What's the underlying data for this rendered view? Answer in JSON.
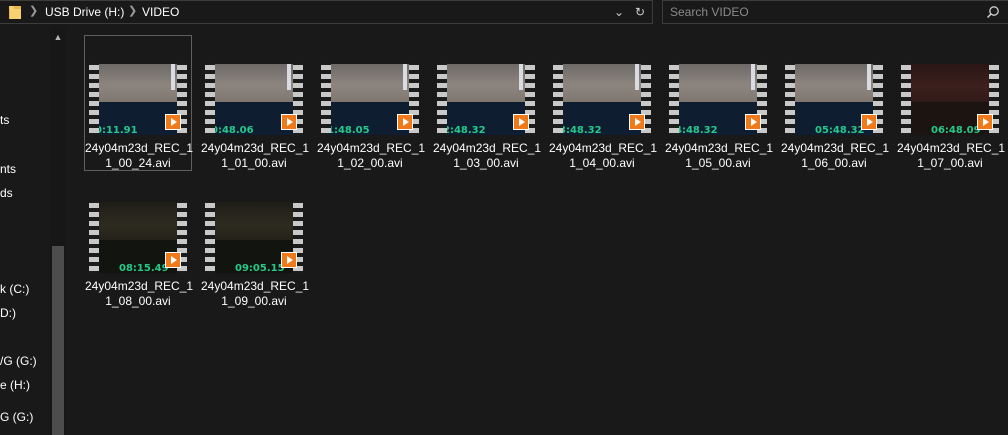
{
  "address": {
    "crumbs": [
      "USB Drive (H:)",
      "VIDEO"
    ],
    "folder_icon": "folder-icon",
    "dropdown_icon": "chevron-down-icon",
    "refresh_icon": "refresh-icon"
  },
  "search": {
    "placeholder": "Search VIDEO",
    "icon": "search-icon"
  },
  "nav": {
    "items": [
      {
        "label": "ts"
      },
      {
        "label": "nts"
      },
      {
        "label": "ds"
      },
      {
        "label": "k (C:)"
      },
      {
        "label": "D:)"
      },
      {
        "label": "/G (G:)"
      },
      {
        "label": "e (H:)"
      },
      {
        "label": "G (G:)"
      }
    ]
  },
  "files": [
    {
      "line1": "24y04m23d_REC_1",
      "line2": "1_00_24.avi",
      "timestamp": "0:11.91",
      "tone": "light",
      "selected": true
    },
    {
      "line1": "24y04m23d_REC_1",
      "line2": "1_01_00.avi",
      "timestamp": "0:48.06",
      "tone": "light",
      "selected": false
    },
    {
      "line1": "24y04m23d_REC_1",
      "line2": "1_02_00.avi",
      "timestamp": "1:48.05",
      "tone": "light",
      "selected": false
    },
    {
      "line1": "24y04m23d_REC_1",
      "line2": "1_03_00.avi",
      "timestamp": "2:48.32",
      "tone": "light",
      "selected": false
    },
    {
      "line1": "24y04m23d_REC_1",
      "line2": "1_04_00.avi",
      "timestamp": "3:48.32",
      "tone": "light",
      "selected": false
    },
    {
      "line1": "24y04m23d_REC_1",
      "line2": "1_05_00.avi",
      "timestamp": "4:48.32",
      "tone": "light",
      "selected": false
    },
    {
      "line1": "24y04m23d_REC_1",
      "line2": "1_06_00.avi",
      "timestamp": "05:48.32",
      "tone": "light",
      "selected": false
    },
    {
      "line1": "24y04m23d_REC_1",
      "line2": "1_07_00.avi",
      "timestamp": "06:48.09",
      "tone": "dark",
      "selected": false
    },
    {
      "line1": "24y04m23d_REC_1",
      "line2": "1_08_00.avi",
      "timestamp": "08:15.49",
      "tone": "darker",
      "selected": false
    },
    {
      "line1": "24y04m23d_REC_1",
      "line2": "1_09_00.avi",
      "timestamp": "09:05.15",
      "tone": "darker",
      "selected": false
    }
  ],
  "colors": {
    "background": "#191919",
    "timestamp_green": "#25c98a",
    "play_orange": "#f07a1a"
  }
}
